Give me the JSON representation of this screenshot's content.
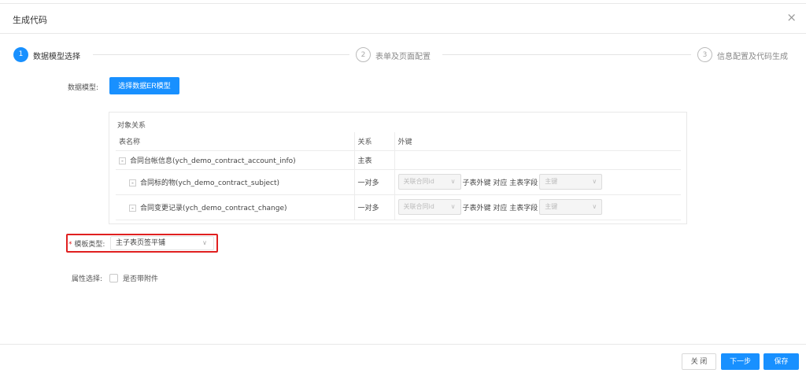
{
  "dialog": {
    "title": "生成代码",
    "close_symbol": "×"
  },
  "steps": [
    {
      "number": "1",
      "label": "数据模型选择",
      "status": "active"
    },
    {
      "number": "2",
      "label": "表单及页面配置",
      "status": "wait"
    },
    {
      "number": "3",
      "label": "信息配置及代码生成",
      "status": "wait"
    }
  ],
  "data_model": {
    "label": "数据模型:",
    "button": "选择数据ER模型"
  },
  "relations": {
    "title": "对象关系",
    "headers": {
      "table_name": "表名称",
      "relation": "关系",
      "foreign_key": "外键"
    },
    "rows": [
      {
        "expander": "-",
        "name": "合同台帐信息(ych_demo_contract_account_info)",
        "relation": "主表"
      },
      {
        "expander": "-",
        "name": "合同标的物(ych_demo_contract_subject)",
        "relation": "一对多",
        "fk_select": "关联合同id",
        "fk_text": "子表外键 对应 主表字段",
        "pk_select": "主键"
      },
      {
        "expander": "-",
        "name": "合同变更记录(ych_demo_contract_change)",
        "relation": "一对多",
        "fk_select": "关联合同id",
        "fk_text": "子表外键 对应 主表字段",
        "pk_select": "主键"
      }
    ]
  },
  "template_type": {
    "required_mark": "*",
    "label": "模板类型:",
    "value": "主子表页签平铺"
  },
  "attribute": {
    "label": "属性选择:",
    "checkbox_label": "是否带附件",
    "checked": false
  },
  "footer": {
    "close": "关 闭",
    "next": "下一步",
    "save": "保存"
  },
  "colors": {
    "primary": "#1890ff",
    "highlight": "#e02020"
  }
}
